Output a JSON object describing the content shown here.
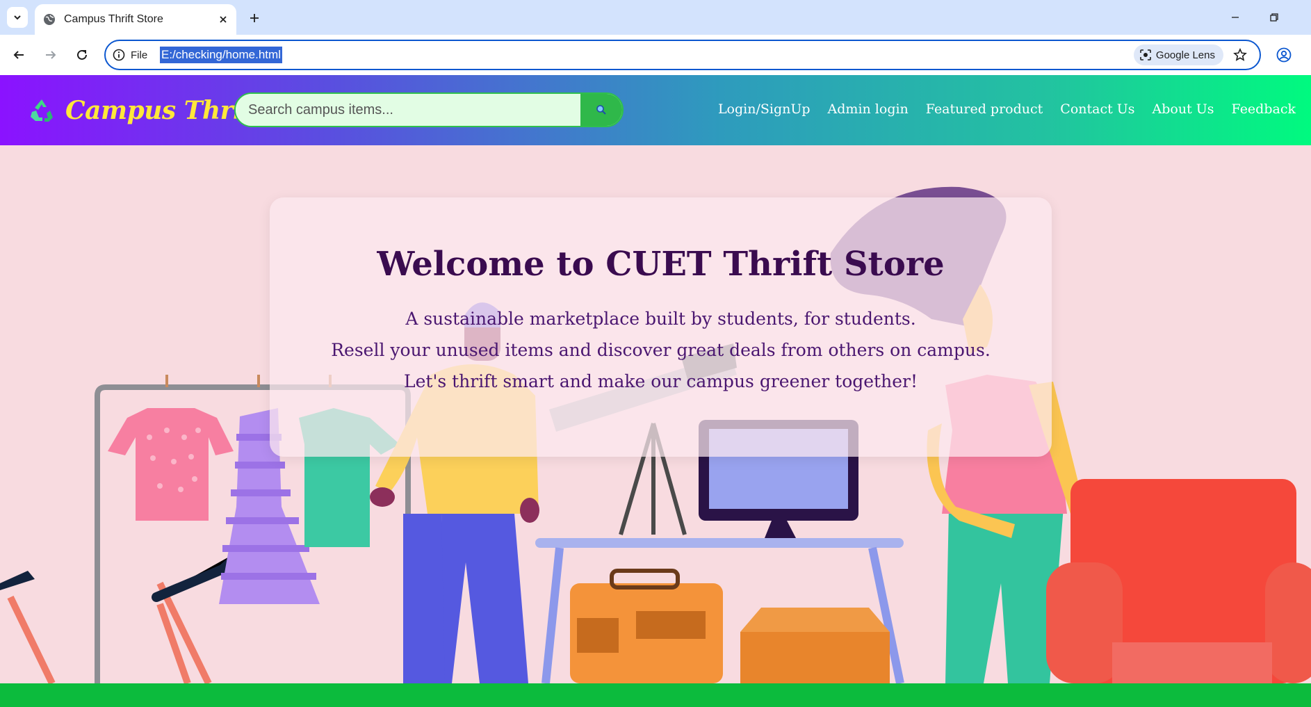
{
  "browser": {
    "tab_title": "Campus Thrift Store",
    "site_info_label": "File",
    "url": "E:/checking/home.html",
    "lens_label": "Google Lens"
  },
  "header": {
    "brand_name": "Campus Thrift",
    "brand_icon": "recycle-icon",
    "search_placeholder": "Search campus items...",
    "nav": [
      "Login/SignUp",
      "Admin login",
      "Featured product",
      "Contact Us",
      "About Us",
      "Feedback"
    ]
  },
  "hero": {
    "title": "Welcome to CUET Thrift Store",
    "lines": [
      "A sustainable marketplace built by students, for students.",
      "Resell your unused items and discover great deals from others on campus.",
      "Let's thrift smart and make our campus greener together!"
    ]
  },
  "colors": {
    "header_gradient_start": "#8b12ff",
    "header_gradient_end": "#00fa7f",
    "brand": "#ffe83a",
    "hero_background": "#f8dbe0",
    "title": "#3a0b4f",
    "footer": "#0cbb3d"
  }
}
